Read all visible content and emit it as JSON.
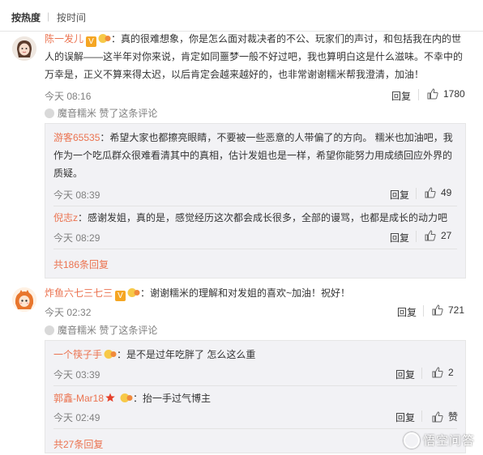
{
  "sort": {
    "hot_label": "按热度",
    "separator": "|",
    "time_label": "按时间"
  },
  "comments": [
    {
      "author": "陈一发儿",
      "text_lines": [
        "：真的很难想象，你是怎么面对裁决者的不公、玩家们的声讨，和包括我在内的世",
        "人的误解——这半年对你来说，肯定如同噩梦一般不好过吧，我也算明白这是什么滋味。不幸中的",
        "万幸是，正义不算来得太迟，以后肯定会越来越好的，也非常谢谢糯米帮我澄清，加油！"
      ],
      "time": "今天 08:16",
      "reply_label": "回复",
      "likes": "1780",
      "liked_by": "魔音糯米 赞了这条评论",
      "replies": [
        {
          "author": "游客65535",
          "text_lines": [
            "：希望大家也都擦亮眼睛，不要被一些恶意的人带偏了的方向。 糯米也加油吧，我",
            "作为一个吃瓜群众很难看清其中的真相，估计发姐也是一样，希望你能努力用成绩回应外界的",
            "质疑。"
          ],
          "time": "今天 08:39",
          "reply_label": "回复",
          "likes": "49"
        },
        {
          "author": "倪志z",
          "text_lines": [
            "：感谢发姐，真的是，感觉经历这次都会成长很多，全部的谩骂，也都是成长的动力吧"
          ],
          "time": "今天 08:29",
          "reply_label": "回复",
          "likes": "27"
        }
      ],
      "more_replies": "共186条回复"
    },
    {
      "author": "炸鱼六七三七三",
      "text_lines": [
        "：谢谢糯米的理解和对发姐的喜欢~加油！祝好！"
      ],
      "time": "今天 02:32",
      "reply_label": "回复",
      "likes": "721",
      "liked_by": "魔音糯米 赞了这条评论",
      "replies": [
        {
          "author": "一个筷子手",
          "text_lines": [
            "：是不是过年吃胖了 怎么这么重"
          ],
          "time": "今天 03:39",
          "reply_label": "回复",
          "likes": "2"
        },
        {
          "author": "郭鑫-Mar18",
          "text_lines": [
            "：抬一手过气博主"
          ],
          "time": "今天 02:49",
          "reply_label": "回复",
          "likes": "赞"
        }
      ],
      "more_replies": "共27条回复"
    }
  ],
  "watermark": "悟空问答"
}
